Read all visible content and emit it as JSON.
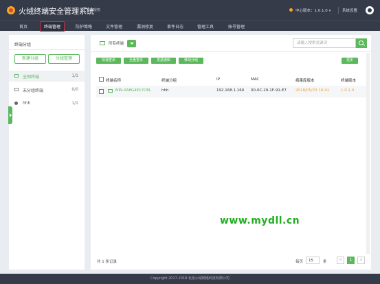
{
  "header": {
    "app_title": "火绒终端安全管理系统",
    "auth_status": "未授权",
    "center_version": "中心版本：1.0.1.0",
    "system_settings": "系统设置"
  },
  "nav": [
    "首页",
    "终端管理",
    "防护策略",
    "文件管理",
    "漏洞修复",
    "事件日志",
    "管理工具",
    "账号管理"
  ],
  "sidebar": {
    "title": "终端分组",
    "new_group": "新建分组",
    "manage_group": "分组管理",
    "groups": [
      {
        "name": "全网终端",
        "count": "1/1"
      },
      {
        "name": "未分组终端",
        "count": "0/0"
      },
      {
        "name": "hhh",
        "count": "1/1"
      }
    ]
  },
  "toolbar": {
    "filter_label": "所有终端",
    "search_placeholder": "请输入搜索关键词",
    "actions": [
      "快速查杀",
      "全盘查杀",
      "发送通知",
      "移动分组"
    ],
    "more": "更多"
  },
  "table": {
    "headers": [
      "终端名称",
      "终端分组",
      "IP",
      "MAC",
      "病毒库版本",
      "终端版本"
    ],
    "rows": [
      {
        "name": "WIN-0A8G4E17CBL",
        "group": "hhh",
        "ip": "192.168.1.160",
        "mac": "00-0C-29-1F-91-E7",
        "virus_db": "2018/05/23 16:41",
        "version": "1.0.1.0"
      }
    ]
  },
  "pagination": {
    "total": "共 1 条记录",
    "per_page_label": "每页",
    "per_page": "15",
    "unit": "条",
    "prev": "<",
    "current": "1",
    "next": ">"
  },
  "footer": "Copyright 2017-2018 北京火绒网络科技有限公司",
  "watermark": "www.mydll.cn",
  "colors": {
    "accent": "#5cb85c",
    "header_bg": "#353b49",
    "orange": "#f0a030"
  }
}
